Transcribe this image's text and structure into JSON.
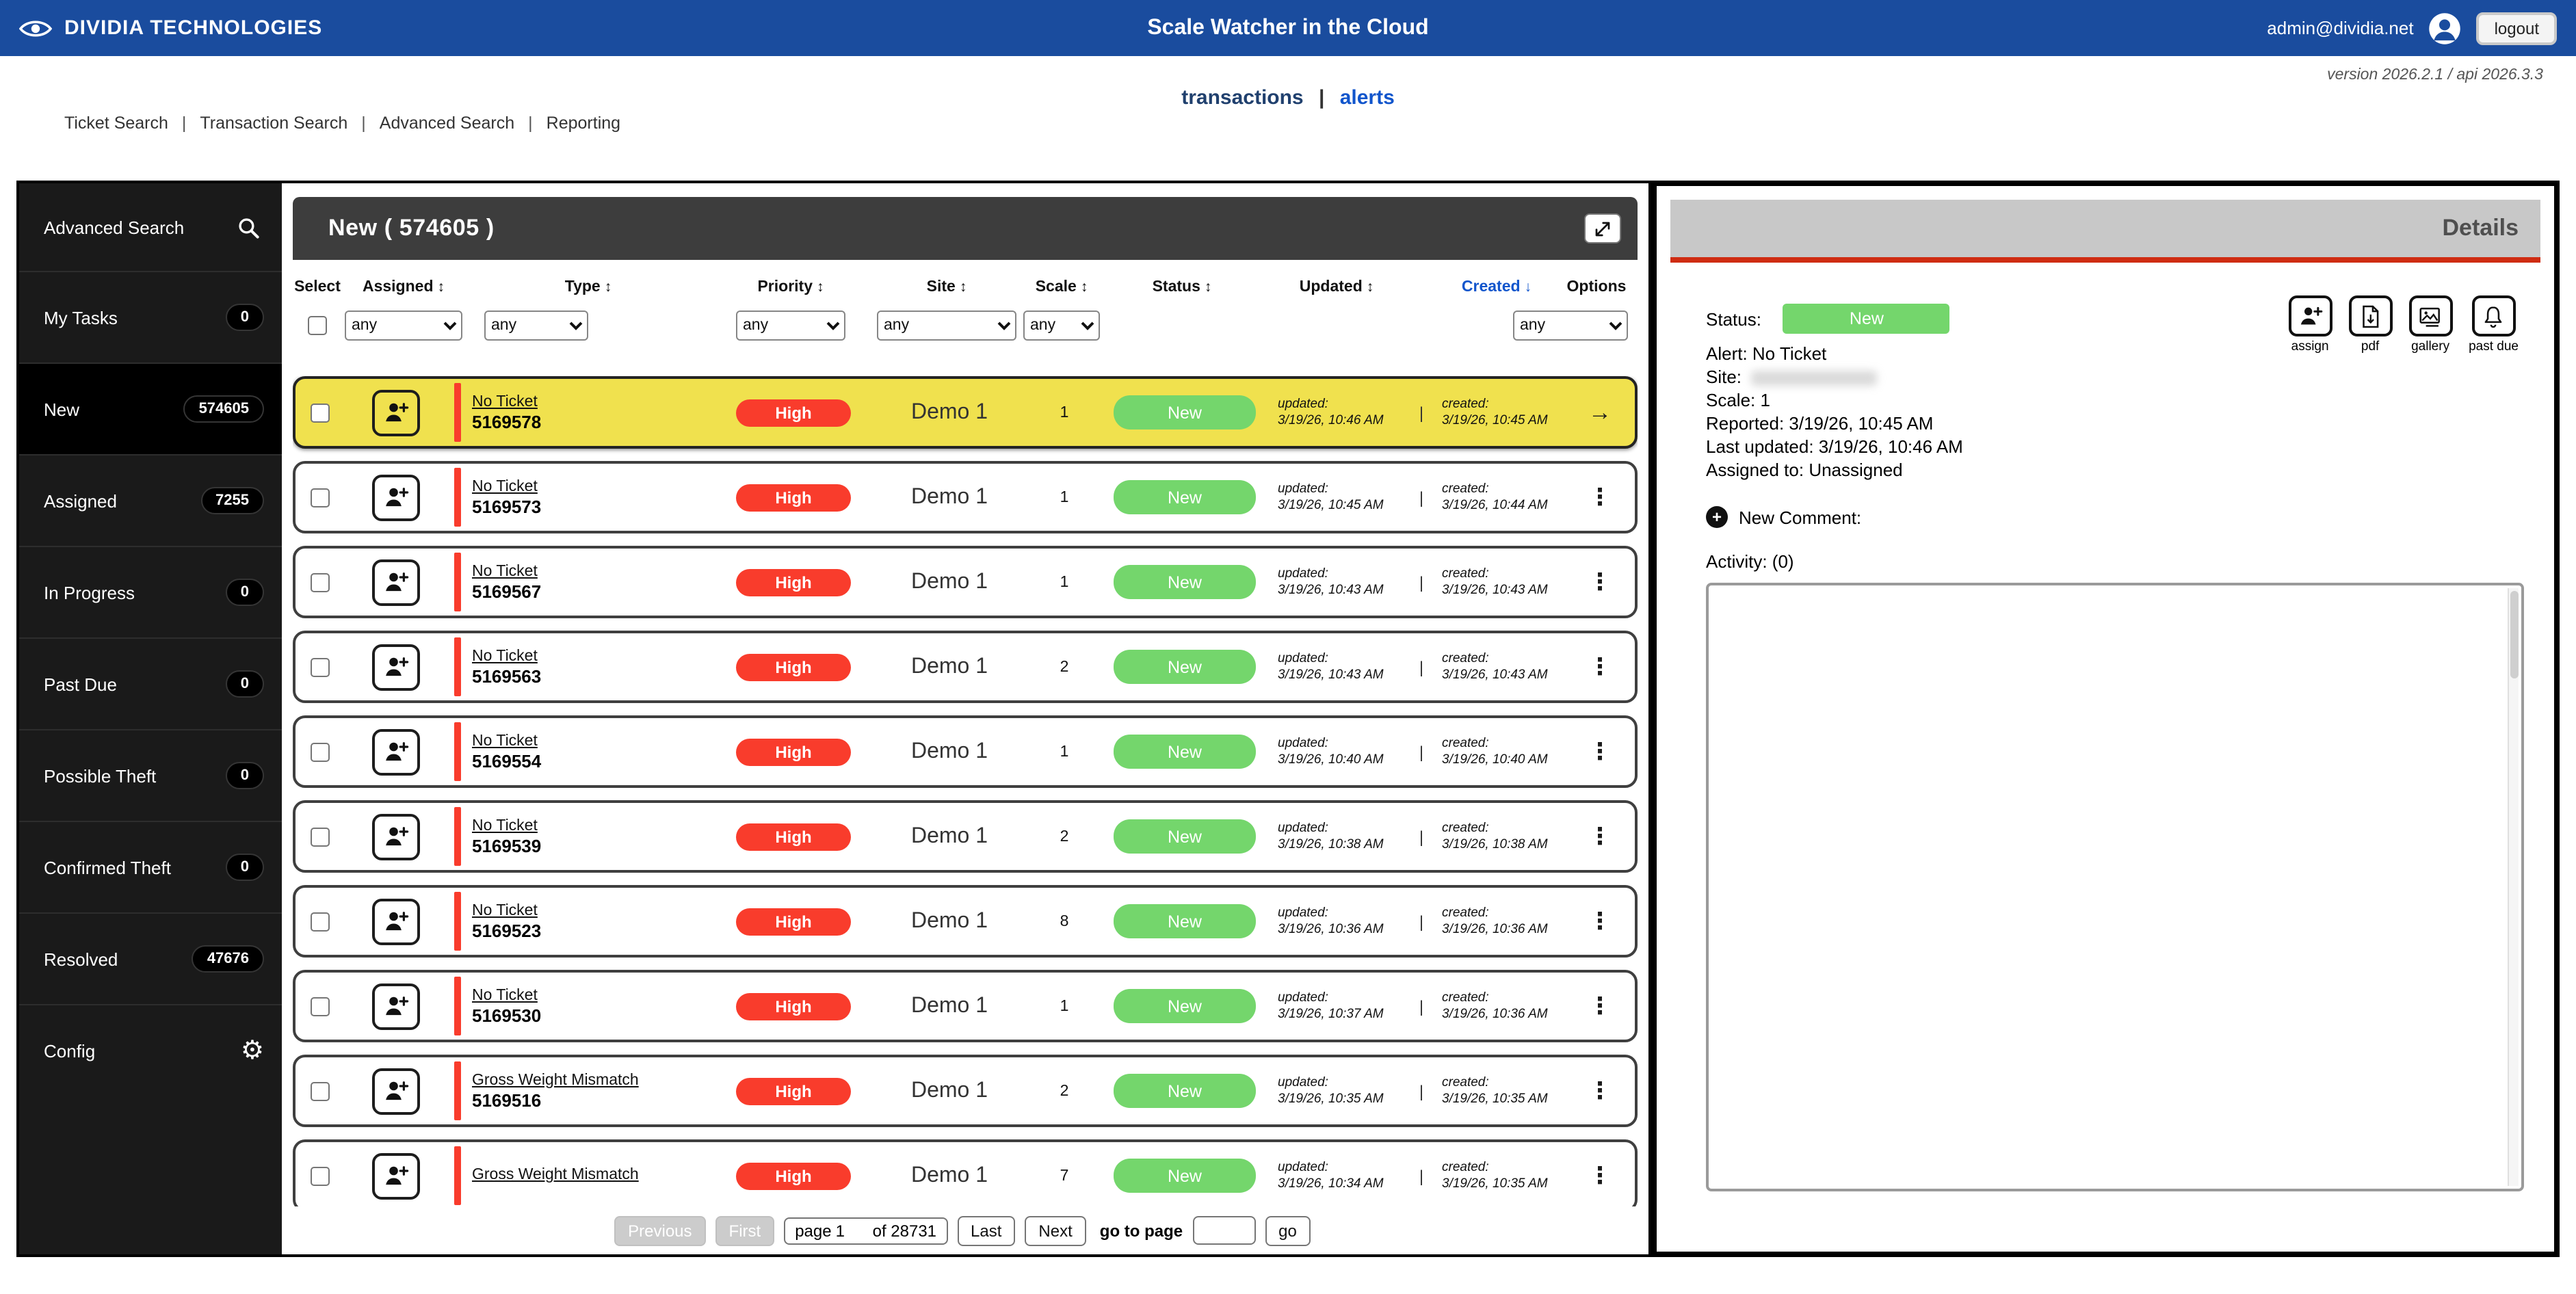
{
  "colors": {
    "topbar_blue": "#1a4c9e",
    "link_blue": "#1155cc",
    "high_red": "#f93c2c",
    "new_green": "#74d66c",
    "selected_yellow": "#f0e14e",
    "sidebar_bg": "#1a1a1a",
    "details_header_gray": "#c8c8c8",
    "details_accent_red": "#cf2c12"
  },
  "icons": {
    "gear": "⚙",
    "kebab": "⋮",
    "arrow_right": "→",
    "sort_both": "↕",
    "sort_desc": "↓",
    "plus": "+",
    "pipe": "|"
  },
  "topbar": {
    "brand": "DIVIDIA TECHNOLOGIES",
    "title": "Scale Watcher in the Cloud",
    "user_email": "admin@dividia.net",
    "logout_label": "logout"
  },
  "subheader": {
    "version_text": "version 2026.2.1  /  api 2026.3.3",
    "tabs": [
      "transactions",
      "alerts"
    ],
    "nav_links": [
      "Ticket Search",
      "Transaction Search",
      "Advanced Search",
      "Reporting"
    ]
  },
  "sidebar": {
    "search_label": "Advanced Search",
    "items": [
      {
        "label": "My Tasks",
        "count": "0"
      },
      {
        "label": "New",
        "count": "574605",
        "active": true
      },
      {
        "label": "Assigned",
        "count": "7255"
      },
      {
        "label": "In Progress",
        "count": "0"
      },
      {
        "label": "Past Due",
        "count": "0"
      },
      {
        "label": "Possible Theft",
        "count": "0"
      },
      {
        "label": "Confirmed Theft",
        "count": "0"
      },
      {
        "label": "Resolved",
        "count": "47676"
      }
    ],
    "config_label": "Config"
  },
  "list_panel": {
    "title": "New ( 574605 )",
    "columns": [
      {
        "label": "Select",
        "sort": ""
      },
      {
        "label": "Assigned",
        "sort": "↕"
      },
      {
        "label": "Type",
        "sort": "↕"
      },
      {
        "label": "Priority",
        "sort": "↕"
      },
      {
        "label": "Site",
        "sort": "↕"
      },
      {
        "label": "Scale",
        "sort": "↕"
      },
      {
        "label": "Status",
        "sort": "↕"
      },
      {
        "label": "Updated",
        "sort": "↕"
      },
      {
        "label": "Created",
        "sort": "↓",
        "active": true
      },
      {
        "label": "Options",
        "sort": ""
      }
    ],
    "filter_value": "any",
    "labels": {
      "updated": "updated:",
      "created": "created:"
    },
    "rows": [
      {
        "type": "No Ticket",
        "ticket": "5169578",
        "priority": "High",
        "site": "Demo 1",
        "scale": "1",
        "status": "New",
        "updated": "3/19/26, 10:46 AM",
        "created": "3/19/26, 10:45 AM",
        "selected": true,
        "action_icon": "→"
      },
      {
        "type": "No Ticket",
        "ticket": "5169573",
        "priority": "High",
        "site": "Demo 1",
        "scale": "1",
        "status": "New",
        "updated": "3/19/26, 10:45 AM",
        "created": "3/19/26, 10:44 AM",
        "action_icon": "⋮"
      },
      {
        "type": "No Ticket",
        "ticket": "5169567",
        "priority": "High",
        "site": "Demo 1",
        "scale": "1",
        "status": "New",
        "updated": "3/19/26, 10:43 AM",
        "created": "3/19/26, 10:43 AM",
        "action_icon": "⋮"
      },
      {
        "type": "No Ticket",
        "ticket": "5169563",
        "priority": "High",
        "site": "Demo 1",
        "scale": "2",
        "status": "New",
        "updated": "3/19/26, 10:43 AM",
        "created": "3/19/26, 10:43 AM",
        "action_icon": "⋮"
      },
      {
        "type": "No Ticket",
        "ticket": "5169554",
        "priority": "High",
        "site": "Demo 1",
        "scale": "1",
        "status": "New",
        "updated": "3/19/26, 10:40 AM",
        "created": "3/19/26, 10:40 AM",
        "action_icon": "⋮"
      },
      {
        "type": "No Ticket",
        "ticket": "5169539",
        "priority": "High",
        "site": "Demo 1",
        "scale": "2",
        "status": "New",
        "updated": "3/19/26, 10:38 AM",
        "created": "3/19/26, 10:38 AM",
        "action_icon": "⋮"
      },
      {
        "type": "No Ticket",
        "ticket": "5169523",
        "priority": "High",
        "site": "Demo 1",
        "scale": "8",
        "status": "New",
        "updated": "3/19/26, 10:36 AM",
        "created": "3/19/26, 10:36 AM",
        "action_icon": "⋮"
      },
      {
        "type": "No Ticket",
        "ticket": "5169530",
        "priority": "High",
        "site": "Demo 1",
        "scale": "1",
        "status": "New",
        "updated": "3/19/26, 10:37 AM",
        "created": "3/19/26, 10:36 AM",
        "action_icon": "⋮"
      },
      {
        "type": "Gross Weight Mismatch",
        "ticket": "5169516",
        "priority": "High",
        "site": "Demo 1",
        "scale": "2",
        "status": "New",
        "updated": "3/19/26, 10:35 AM",
        "created": "3/19/26, 10:35 AM",
        "action_icon": "⋮"
      },
      {
        "type": "Gross Weight Mismatch",
        "ticket": "",
        "priority": "High",
        "site": "Demo 1",
        "scale": "7",
        "status": "New",
        "updated": "3/19/26, 10:34 AM",
        "created": "3/19/26, 10:35 AM",
        "action_icon": "⋮"
      }
    ],
    "pagination": {
      "previous": "Previous",
      "first": "First",
      "page_label": "page",
      "page_value": "1",
      "of_label": "of 28731",
      "last": "Last",
      "next": "Next",
      "goto_label": "go to page",
      "go": "go"
    }
  },
  "details_panel": {
    "title": "Details",
    "status_label": "Status:",
    "status_value": "New",
    "alert": "Alert: No Ticket",
    "site_label": "Site:",
    "scale": "Scale: 1",
    "reported": "Reported: 3/19/26, 10:45 AM",
    "last_updated": "Last updated: 3/19/26, 10:46 AM",
    "assigned_to": "Assigned to: Unassigned",
    "new_comment_label": "New Comment:",
    "activity_label": "Activity: (0)",
    "actions": [
      {
        "label": "assign"
      },
      {
        "label": "pdf"
      },
      {
        "label": "gallery"
      },
      {
        "label": "past due"
      }
    ]
  }
}
